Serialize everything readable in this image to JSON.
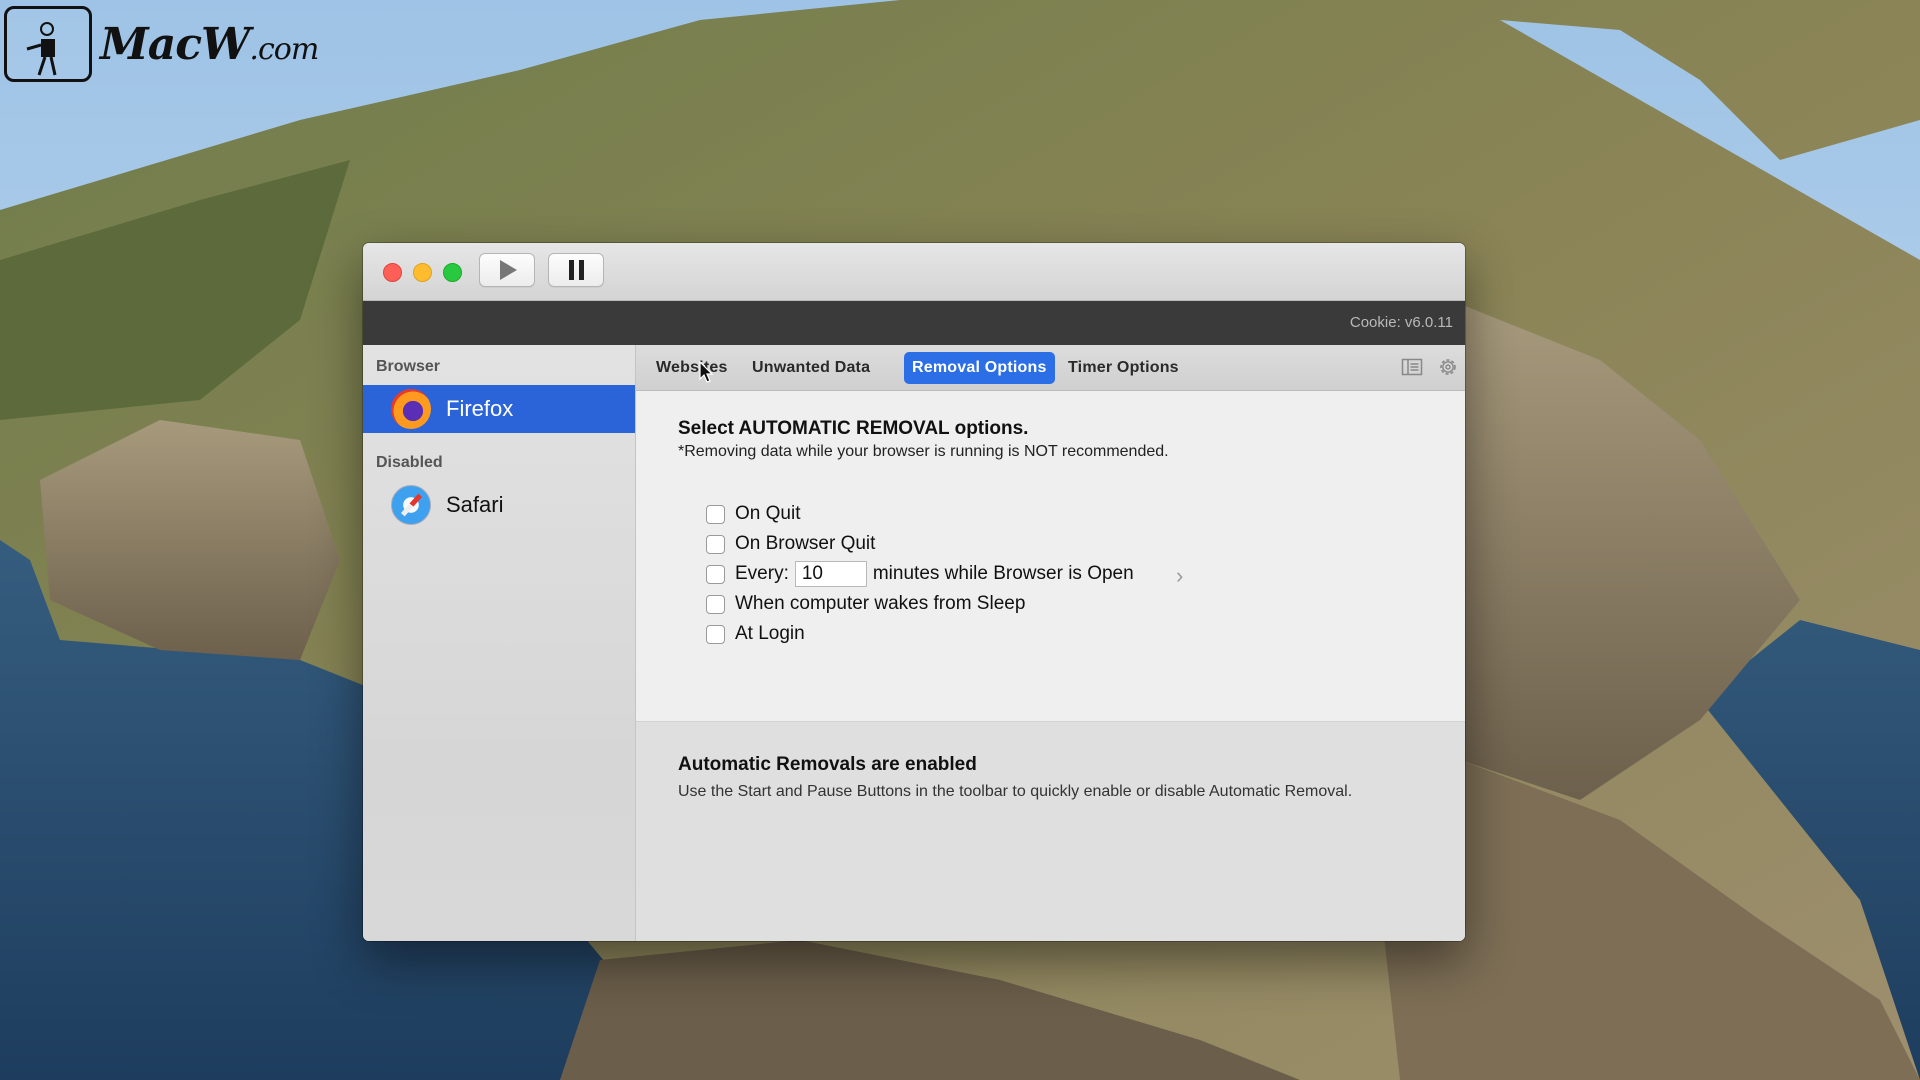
{
  "watermark": {
    "brand": "MacW",
    "suffix": ".com"
  },
  "window": {
    "version": "Cookie: v6.0.11",
    "toolbar": {
      "play_icon": "play-icon",
      "pause_icon": "pause-icon"
    }
  },
  "sidebar": {
    "sections": [
      {
        "header": "Browser",
        "items": [
          {
            "label": "Firefox",
            "icon": "firefox-icon",
            "selected": true
          }
        ]
      },
      {
        "header": "Disabled",
        "items": [
          {
            "label": "Safari",
            "icon": "safari-icon",
            "selected": false
          }
        ]
      }
    ]
  },
  "tabs": [
    {
      "label": "Websites",
      "active": false
    },
    {
      "label": "Unwanted Data",
      "active": false
    },
    {
      "label": "Removal Options",
      "active": true
    },
    {
      "label": "Timer Options",
      "active": false
    }
  ],
  "content": {
    "heading": "Select AUTOMATIC REMOVAL options.",
    "note": "*Removing data while your browser is running is NOT recommended.",
    "options": [
      {
        "label": "On Quit",
        "checked": false
      },
      {
        "label": "On Browser Quit",
        "checked": false
      },
      {
        "label_prefix": "Every:",
        "value": "10",
        "label_suffix": "minutes while Browser is Open",
        "checked": false
      },
      {
        "label": "When computer wakes from Sleep",
        "checked": false
      },
      {
        "label": "At Login",
        "checked": false
      }
    ]
  },
  "footer": {
    "title": "Automatic Removals are enabled",
    "text": "Use the Start and Pause Buttons in the toolbar to quickly enable or disable Automatic Removal."
  },
  "colors": {
    "accent": "#2b6ee6",
    "selection": "#2b63d9"
  }
}
